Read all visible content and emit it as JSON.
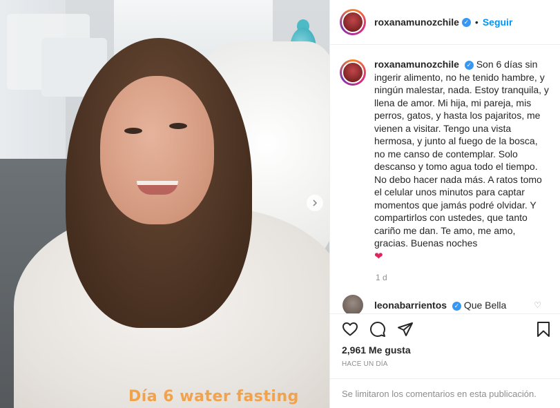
{
  "photo": {
    "overlay_caption": "Día 6 water fasting",
    "next_icon": "chevron-right-icon"
  },
  "header": {
    "username": "roxanamunozchile",
    "verified_icon": "verified-badge-icon",
    "separator": "•",
    "follow_label": "Seguir"
  },
  "caption": {
    "username": "roxanamunozchile",
    "text": "Son 6 días sin ingerir alimento, no he tenido hambre, y ningún malestar, nada. Estoy tranquila, y llena de amor. Mi hija, mi pareja, mis perros, gatos, y hasta los pajaritos, me vienen a visitar. Tengo una vista hermosa, y junto al fuego de la bosca, no me canso de contemplar. Solo descanso y tomo agua todo el tiempo. No debo hacer nada más. A ratos tomo el celular unos minutos para captar momentos que jamás podré olvidar. Y compartirlos con ustedes, que tanto cariño me dan. Te amo, me amo, gracias. Buenas noches",
    "emoji": "❤",
    "time_ago": "1 d"
  },
  "reply": {
    "username": "leonabarrientos",
    "text": "Que Bella"
  },
  "actions": {
    "icons": [
      "heart-icon",
      "comment-icon",
      "share-icon",
      "bookmark-icon"
    ],
    "likes_text": "2,961 Me gusta",
    "posted_when": "HACE UN DÍA"
  },
  "footer": {
    "limited_comments": "Se limitaron los comentarios en esta publicación."
  },
  "colors": {
    "link_blue": "#0095f6",
    "verified_blue": "#3897f0",
    "caption_orange": "#f2a24a",
    "muted_gray": "#8e8e8e"
  }
}
